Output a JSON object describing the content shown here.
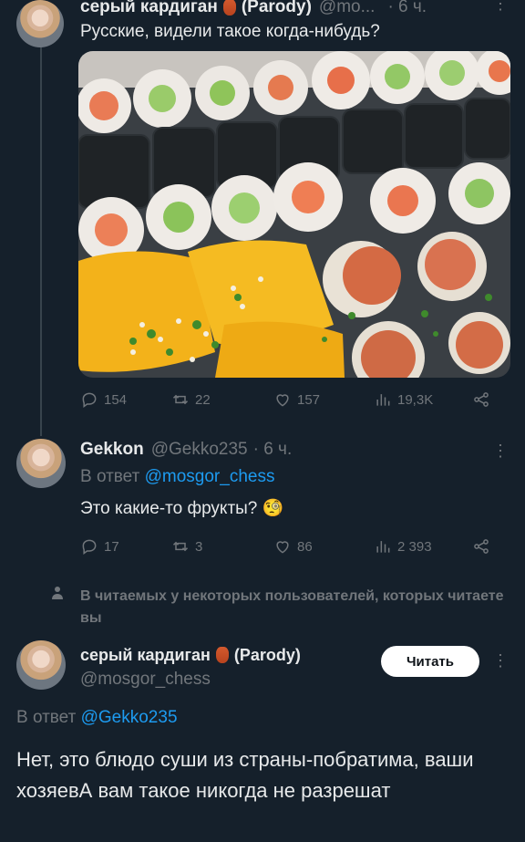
{
  "tweet1": {
    "name": "серый кардиган",
    "badge": "(Parody)",
    "handle": "@mo...",
    "time": "· 6 ч.",
    "text": "Русские, видели такое когда-нибудь?",
    "stats": {
      "replies": "154",
      "retweets": "22",
      "likes": "157",
      "views": "19,3K"
    }
  },
  "tweet2": {
    "name": "Gekkon",
    "handle": "@Gekko235",
    "time": "· 6 ч.",
    "reply_prefix": "В ответ",
    "reply_to": "@mosgor_chess",
    "text": "Это какие-то фрукты? 🧐",
    "stats": {
      "replies": "17",
      "retweets": "3",
      "likes": "86",
      "views": "2 393"
    }
  },
  "followers_note": "В читаемых у некоторых пользователей, которых читаете вы",
  "tweet3": {
    "name": "серый кардиган",
    "badge": "(Parody)",
    "handle": "@mosgor_chess",
    "follow_label": "Читать",
    "reply_prefix": "В ответ",
    "reply_to": "@Gekko235",
    "text": "Нет, это блюдо суши из страны-побратима, ваши хозяевА вам такое никогда не разрешат"
  },
  "icons": [
    "reply-icon",
    "retweet-icon",
    "like-icon",
    "views-icon",
    "share-icon",
    "more-icon",
    "person-icon",
    "amphora-emoji"
  ],
  "colors": {
    "background": "#15202b",
    "text": "#e7e9ea",
    "muted": "#71767b",
    "link": "#1d9bf0",
    "thread_line": "#38444d"
  }
}
